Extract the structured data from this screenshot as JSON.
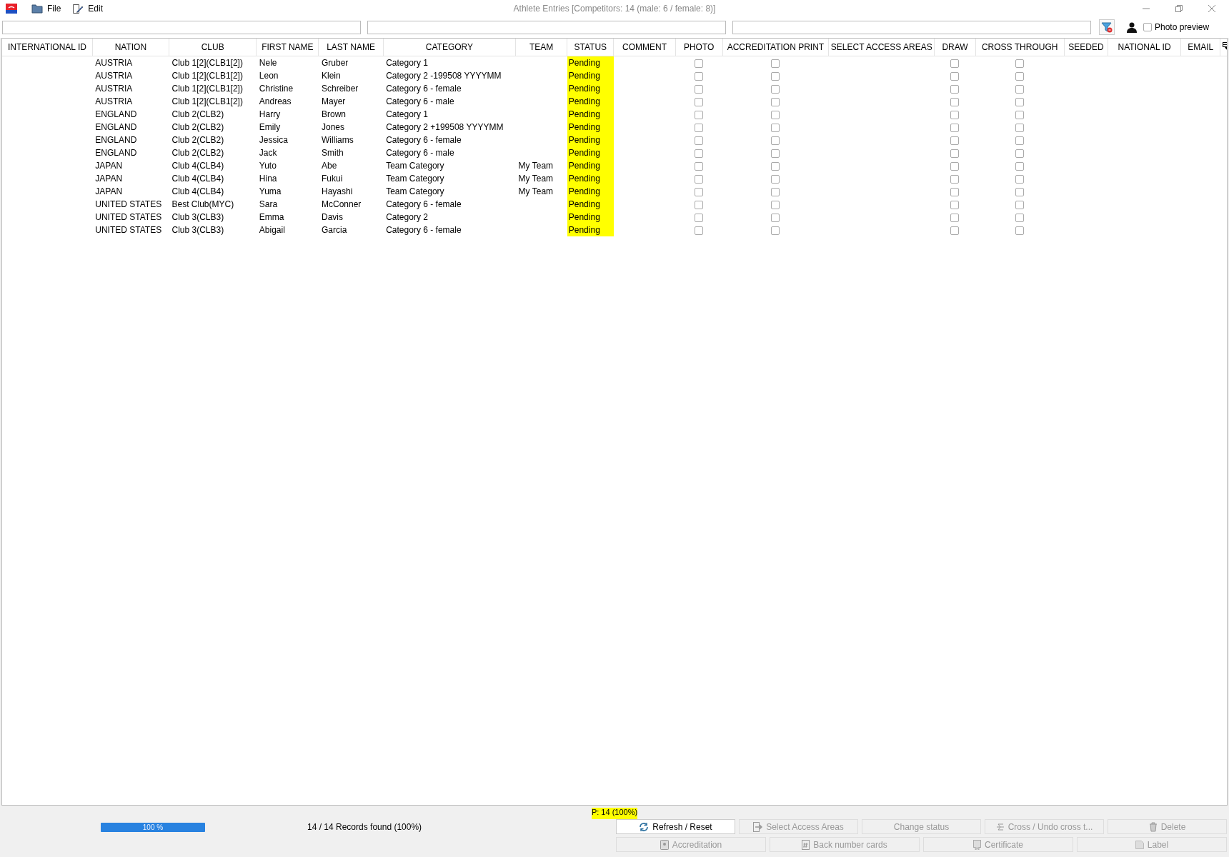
{
  "window": {
    "title": "Athlete Entries [Competitors: 14 (male: 6 / female: 8)]"
  },
  "menu": [
    {
      "label": "File"
    },
    {
      "label": "Edit"
    }
  ],
  "photo_preview": {
    "label": "Photo preview",
    "checked": false
  },
  "columns": [
    "INTERNATIONAL ID",
    "NATION",
    "CLUB",
    "FIRST NAME",
    "LAST NAME",
    "CATEGORY",
    "TEAM",
    "STATUS",
    "COMMENT",
    "PHOTO",
    "ACCREDITATION PRINT",
    "SELECT ACCESS AREAS",
    "DRAW",
    "CROSS THROUGH",
    "SEEDED",
    "NATIONAL ID",
    "EMAIL"
  ],
  "rows": [
    {
      "nation": "AUSTRIA",
      "club": "Club 1[2](CLB1[2])",
      "first_name": "Nele",
      "last_name": "Gruber",
      "category": "Category 1",
      "status": "Pending",
      "photo": false,
      "accreditation_print": false,
      "draw": false,
      "cross_through": false
    },
    {
      "nation": "AUSTRIA",
      "club": "Club 1[2](CLB1[2])",
      "first_name": "Leon",
      "last_name": "Klein",
      "category": "Category 2 -199508 YYYYMM",
      "status": "Pending",
      "photo": false,
      "accreditation_print": false,
      "draw": false,
      "cross_through": false
    },
    {
      "nation": "AUSTRIA",
      "club": "Club 1[2](CLB1[2])",
      "first_name": "Christine",
      "last_name": "Schreiber",
      "category": "Category 6 - female",
      "status": "Pending",
      "photo": false,
      "accreditation_print": false,
      "draw": false,
      "cross_through": false
    },
    {
      "nation": "AUSTRIA",
      "club": "Club 1[2](CLB1[2])",
      "first_name": "Andreas",
      "last_name": "Mayer",
      "category": "Category 6 - male",
      "status": "Pending",
      "photo": false,
      "accreditation_print": false,
      "draw": false,
      "cross_through": false
    },
    {
      "nation": "ENGLAND",
      "club": "Club 2(CLB2)",
      "first_name": "Harry",
      "last_name": "Brown",
      "category": "Category 1",
      "status": "Pending",
      "photo": false,
      "accreditation_print": false,
      "draw": false,
      "cross_through": false
    },
    {
      "nation": "ENGLAND",
      "club": "Club 2(CLB2)",
      "first_name": "Emily",
      "last_name": "Jones",
      "category": "Category 2 +199508 YYYYMM",
      "status": "Pending",
      "photo": false,
      "accreditation_print": false,
      "draw": false,
      "cross_through": false
    },
    {
      "nation": "ENGLAND",
      "club": "Club 2(CLB2)",
      "first_name": "Jessica",
      "last_name": "Williams",
      "category": "Category 6 - female",
      "status": "Pending",
      "photo": false,
      "accreditation_print": false,
      "draw": false,
      "cross_through": false
    },
    {
      "nation": "ENGLAND",
      "club": "Club 2(CLB2)",
      "first_name": "Jack",
      "last_name": "Smith",
      "category": "Category 6 - male",
      "status": "Pending",
      "photo": false,
      "accreditation_print": false,
      "draw": false,
      "cross_through": false
    },
    {
      "nation": "JAPAN",
      "club": "Club 4(CLB4)",
      "first_name": "Yuto",
      "last_name": "Abe",
      "category": "Team Category",
      "team": "My Team",
      "status": "Pending",
      "photo": false,
      "accreditation_print": false,
      "draw": false,
      "cross_through": false
    },
    {
      "nation": "JAPAN",
      "club": "Club 4(CLB4)",
      "first_name": "Hina",
      "last_name": "Fukui",
      "category": "Team Category",
      "team": "My Team",
      "status": "Pending",
      "photo": false,
      "accreditation_print": false,
      "draw": false,
      "cross_through": false
    },
    {
      "nation": "JAPAN",
      "club": "Club 4(CLB4)",
      "first_name": "Yuma",
      "last_name": "Hayashi",
      "category": "Team Category",
      "team": "My Team",
      "status": "Pending",
      "photo": false,
      "accreditation_print": false,
      "draw": false,
      "cross_through": false
    },
    {
      "nation": "UNITED STATES",
      "club": "Best Club(MYC)",
      "first_name": "Sara",
      "last_name": "McConner",
      "category": "Category 6 - female",
      "status": "Pending",
      "photo": false,
      "accreditation_print": false,
      "draw": false,
      "cross_through": false
    },
    {
      "nation": "UNITED STATES",
      "club": "Club 3(CLB3)",
      "first_name": "Emma",
      "last_name": "Davis",
      "category": "Category 2",
      "status": "Pending",
      "photo": false,
      "accreditation_print": false,
      "draw": false,
      "cross_through": false
    },
    {
      "nation": "UNITED STATES",
      "club": "Club 3(CLB3)",
      "first_name": "Abigail",
      "last_name": "Garcia",
      "category": "Category 6 - female",
      "status": "Pending",
      "photo": false,
      "accreditation_print": false,
      "draw": false,
      "cross_through": false
    }
  ],
  "status_summary": "P: 14 (100%)",
  "progress": {
    "level": 1,
    "label": "100 %"
  },
  "records_found": "14 / 14 Records found (100%)",
  "buttons": [
    {
      "label": "Refresh / Reset",
      "kind": "refresh",
      "disabled": false
    },
    {
      "label": "Select Access Areas",
      "kind": "access",
      "disabled": true
    },
    {
      "label": "Change status",
      "kind": "none",
      "disabled": true
    },
    {
      "label": "Cross / Undo cross t...",
      "kind": "cross",
      "disabled": true
    },
    {
      "label": "Delete",
      "kind": "delete",
      "disabled": true
    }
  ],
  "buttons_row2": [
    {
      "label": "Accreditation",
      "kind": "accreditation",
      "disabled": true
    },
    {
      "label": "Back number cards",
      "kind": "number",
      "disabled": true
    },
    {
      "label": "Certificate",
      "kind": "certificate",
      "disabled": true
    },
    {
      "label": "Label",
      "kind": "label",
      "disabled": true
    }
  ]
}
